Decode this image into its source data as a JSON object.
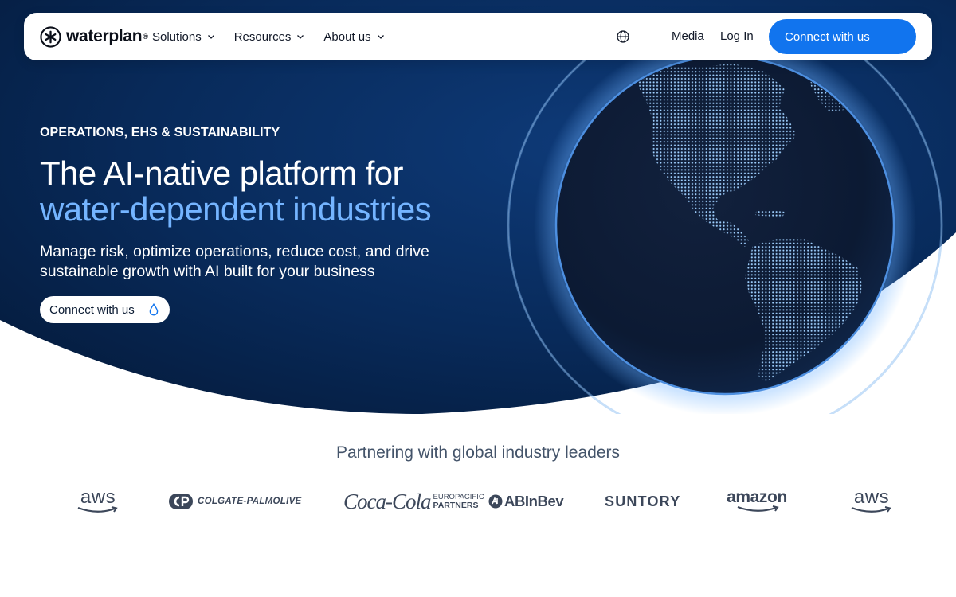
{
  "brand": {
    "name": "waterplan",
    "registered_mark": "®"
  },
  "nav": {
    "menu": [
      {
        "label": "Solutions"
      },
      {
        "label": "Resources"
      },
      {
        "label": "About us"
      }
    ],
    "language_icon": "globe-icon",
    "media_label": "Media",
    "login_label": "Log In",
    "cta_label": "Connect with us"
  },
  "hero": {
    "eyebrow": "OPERATIONS, EHS & SUSTAINABILITY",
    "headline_line1": "The AI-native platform for",
    "headline_line2": "water-dependent industries",
    "subhead": "Manage risk, optimize operations, reduce cost, and drive sustainable growth with AI built for your business",
    "button_label": "Connect with us",
    "button_icon": "water-drop-icon",
    "illustration": "dotted-earth-globe-americas"
  },
  "partners": {
    "title": "Partnering with global industry leaders",
    "logos": [
      {
        "name": "aws",
        "text": "aws"
      },
      {
        "name": "colgate-palmolive",
        "text": "COLGATE-PALMOLIVE"
      },
      {
        "name": "coca-cola-europacific-partners",
        "script": "Coca-Cola",
        "line1": "EUROPACIFIC",
        "line2": "PARTNERS"
      },
      {
        "name": "ab-inbev",
        "text": "ABInBev"
      },
      {
        "name": "suntory",
        "text": "SUNTORY"
      },
      {
        "name": "amazon",
        "text": "amazon"
      },
      {
        "name": "aws",
        "text": "aws"
      }
    ]
  },
  "colors": {
    "hero_dark": "#051a3d",
    "hero_blue": "#0a2f66",
    "accent_blue": "#1174ee",
    "headline_highlight": "#74b4ff",
    "logo_gray": "#3c475a"
  }
}
